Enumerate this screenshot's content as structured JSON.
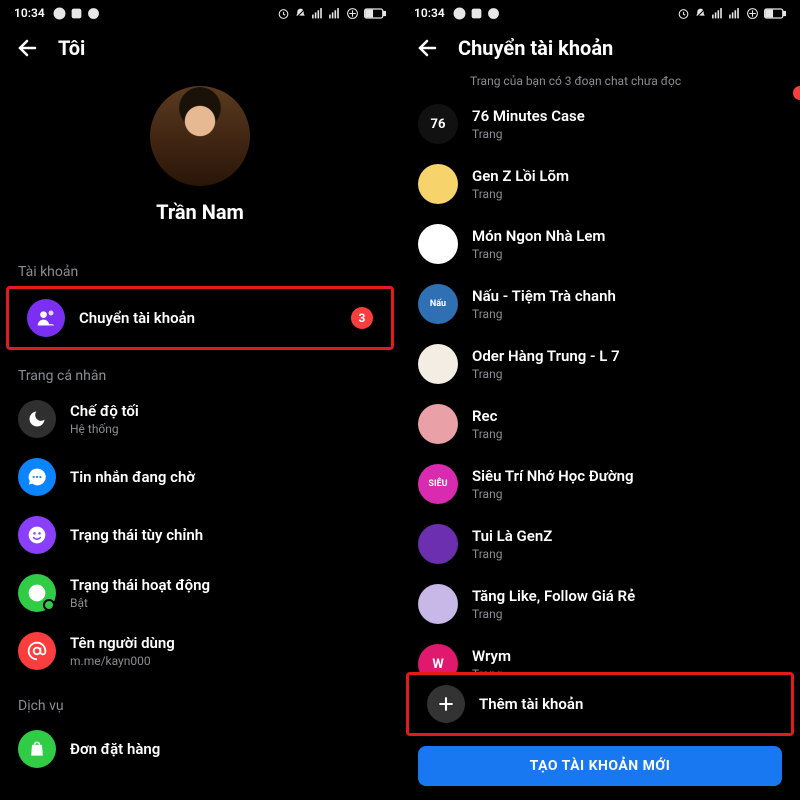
{
  "status": {
    "time": "10:34"
  },
  "left": {
    "title": "Tôi",
    "profile_name": "Trần Nam",
    "sections": {
      "account": "Tài khoản",
      "profile": "Trang cá nhân",
      "services": "Dịch vụ"
    },
    "switch_account": {
      "label": "Chuyển tài khoản",
      "badge": "3"
    },
    "rows": {
      "dark_mode": {
        "label": "Chế độ tối",
        "sub": "Hệ thống"
      },
      "msg_requests": {
        "label": "Tin nhắn đang chờ"
      },
      "custom_status": {
        "label": "Trạng thái tùy chỉnh"
      },
      "active_status": {
        "label": "Trạng thái hoạt động",
        "sub": "Bật"
      },
      "username": {
        "label": "Tên người dùng",
        "sub": "m.me/kayn000"
      },
      "orders": {
        "label": "Đơn đặt hàng"
      }
    }
  },
  "right": {
    "title": "Chuyển tài khoản",
    "unread_sub": "Trang của bạn có 3 đoạn chat chưa đọc",
    "trang": "Trang",
    "accounts": [
      {
        "name": "76 Minutes Case",
        "bg": "#111111",
        "initial": "76"
      },
      {
        "name": "Gen Z Lồi Lõm",
        "bg": "#f6d36b",
        "initial": ""
      },
      {
        "name": "Món Ngon Nhà Lem",
        "bg": "#ffffff",
        "initial": ""
      },
      {
        "name": "Nấu - Tiệm Trà chanh",
        "bg": "#2f6fb4",
        "initial": "Nấu"
      },
      {
        "name": "Oder Hàng Trung - L  7",
        "bg": "#f3ede3",
        "initial": ""
      },
      {
        "name": "Rec",
        "bg": "#e9a1a7",
        "initial": ""
      },
      {
        "name": "Siêu Trí Nhớ Học Đường",
        "bg": "#d92bb0",
        "initial": "SIÊU"
      },
      {
        "name": "Tui Là GenZ",
        "bg": "#6b2fb0",
        "initial": ""
      },
      {
        "name": "Tăng Like, Follow Giá Rẻ",
        "bg": "#c7b8e8",
        "initial": ""
      },
      {
        "name": "Wrym",
        "bg": "#e0196e",
        "initial": "W"
      }
    ],
    "add_account": "Thêm tài khoản",
    "create_cta": "TẠO TÀI KHOẢN MỚI"
  }
}
